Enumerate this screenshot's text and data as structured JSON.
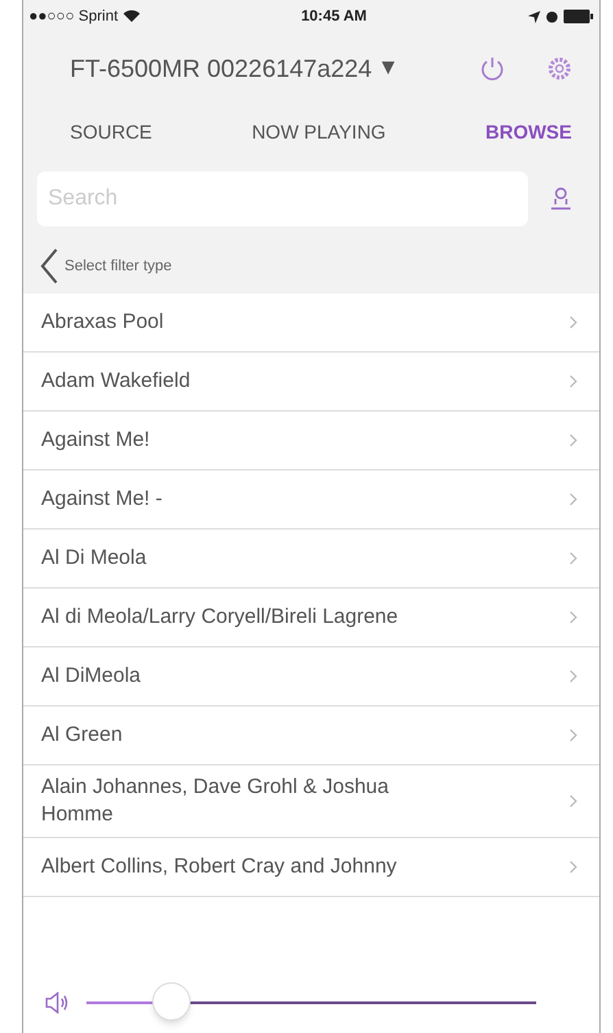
{
  "status_bar": {
    "carrier": "●●○○○ Sprint",
    "time": "10:45 AM"
  },
  "header": {
    "device": "FT-6500MR 00226147a224",
    "dropdown": "▼"
  },
  "tabs": [
    {
      "label": "SOURCE",
      "selected": false
    },
    {
      "label": "NOW PLAYING",
      "selected": false
    },
    {
      "label": "BROWSE",
      "selected": true
    }
  ],
  "search": {
    "placeholder": "Search"
  },
  "filter": {
    "label": "Select filter type"
  },
  "items": [
    "Abraxas Pool",
    "Adam Wakefield",
    "Against Me!",
    "Against Me! -",
    "Al Di Meola",
    "Al di Meola/Larry Coryell/Bireli Lagrene",
    "Al DiMeola",
    "Al Green",
    "Alain Johannes, Dave Grohl & Joshua Homme",
    "Albert Collins, Robert Cray and Johnny"
  ],
  "volume": {
    "level": 0.19
  }
}
